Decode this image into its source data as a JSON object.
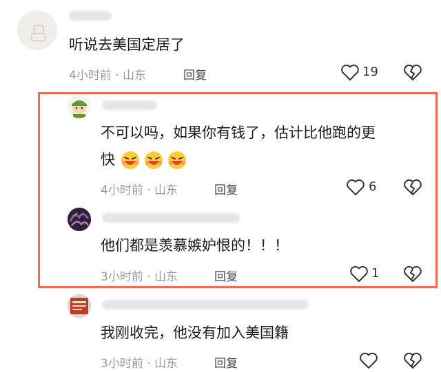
{
  "comments": [
    {
      "text": "听说去美国定居了",
      "time": "4小时前",
      "location": "山东",
      "reply_label": "回复",
      "likes": "19"
    },
    {
      "text_line1": "不可以吗，如果你有钱了，估计比他跑的更",
      "text_line2": "快",
      "emojis": [
        "grin-emoji",
        "grin-emoji",
        "grin-emoji"
      ],
      "time": "4小时前",
      "location": "山东",
      "reply_label": "回复",
      "likes": "6"
    },
    {
      "text": "他们都是羡慕嫉妒恨的！！！",
      "time": "3小时前",
      "location": "山东",
      "reply_label": "回复",
      "likes": "1"
    },
    {
      "text": "我刚收完，他没有加入美国籍",
      "time": "3小时前",
      "location": "山东",
      "reply_label": "回复",
      "likes": ""
    }
  ],
  "separator": "·",
  "colors": {
    "highlight_border": "#f26a4f",
    "meta": "#9a9aa0"
  }
}
